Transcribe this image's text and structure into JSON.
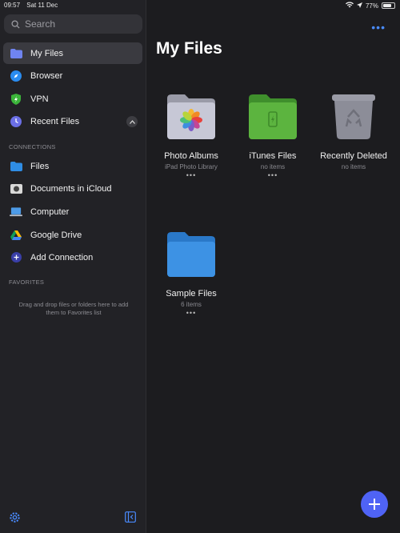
{
  "status": {
    "time": "09:57",
    "date": "Sat 11 Dec",
    "battery": "77%",
    "battery_level": 0.77
  },
  "sidebar": {
    "search_placeholder": "Search",
    "items": [
      {
        "label": "My Files",
        "icon": "folder-icon",
        "active": true
      },
      {
        "label": "Browser",
        "icon": "compass-icon"
      },
      {
        "label": "VPN",
        "icon": "shield-icon"
      },
      {
        "label": "Recent Files",
        "icon": "clock-icon"
      }
    ],
    "connections_header": "CONNECTIONS",
    "connections": [
      {
        "label": "Files",
        "icon": "files-folder-icon"
      },
      {
        "label": "Documents in iCloud",
        "icon": "documents-icon"
      },
      {
        "label": "Computer",
        "icon": "laptop-icon"
      },
      {
        "label": "Google Drive",
        "icon": "google-drive-icon"
      },
      {
        "label": "Add Connection",
        "icon": "plus-circle-icon"
      }
    ],
    "favorites_header": "FAVORITES",
    "favorites_hint": "Drag and drop files or folders here to add them to Favorites list"
  },
  "main": {
    "title": "My Files",
    "more": "•••",
    "tiles": [
      {
        "name": "Photo Albums",
        "sub": "iPad Photo Library",
        "dots": "•••"
      },
      {
        "name": "iTunes Files",
        "sub": "no items",
        "dots": "•••"
      },
      {
        "name": "Recently Deleted",
        "sub": "no items",
        "dots": ""
      },
      {
        "name": "Sample Files",
        "sub": "6 items",
        "dots": "•••"
      }
    ]
  },
  "colors": {
    "accent": "#4f63f5",
    "folder_blue": "#3d8ee0",
    "folder_green": "#59b33e"
  }
}
